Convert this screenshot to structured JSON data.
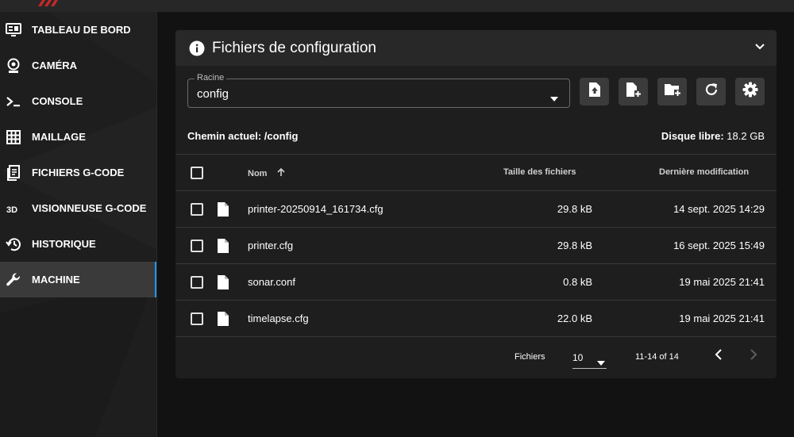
{
  "colors": {
    "accent": "#2196f3",
    "brand": "#c62828",
    "background": "#121212",
    "card": "#1e1e1e"
  },
  "sidebar": {
    "items": [
      {
        "label": "TABLEAU DE BORD",
        "icon": "monitor-dashboard-icon",
        "active": false
      },
      {
        "label": "CAMÉRA",
        "icon": "webcam-icon",
        "active": false
      },
      {
        "label": "CONSOLE",
        "icon": "console-icon",
        "active": false
      },
      {
        "label": "MAILLAGE",
        "icon": "grid-icon",
        "active": false
      },
      {
        "label": "FICHIERS G-CODE",
        "icon": "file-document-icon",
        "active": false
      },
      {
        "label": "VISIONNEUSE G-CODE",
        "icon": "3d-icon",
        "active": false
      },
      {
        "label": "HISTORIQUE",
        "icon": "history-icon",
        "active": false
      },
      {
        "label": "MACHINE",
        "icon": "wrench-icon",
        "active": true
      }
    ]
  },
  "panel": {
    "title": "Fichiers de configuration",
    "root_select": {
      "legend": "Racine",
      "value": "config"
    },
    "toolbar": [
      "upload-file-icon",
      "new-file-icon",
      "new-folder-icon",
      "refresh-icon",
      "settings-icon"
    ],
    "current_path_label": "Chemin actuel: /config",
    "disk_free_label": "Disque libre:",
    "disk_free_value": "18.2 GB"
  },
  "table": {
    "headers": {
      "name": "Nom",
      "size": "Taille des fichiers",
      "modified": "Dernière modification"
    },
    "rows": [
      {
        "name": "printer-20250914_161734.cfg",
        "size": "29.8 kB",
        "modified": "14 sept. 2025 14:29"
      },
      {
        "name": "printer.cfg",
        "size": "29.8 kB",
        "modified": "16 sept. 2025 15:49"
      },
      {
        "name": "sonar.conf",
        "size": "0.8 kB",
        "modified": "19 mai 2025 21:41"
      },
      {
        "name": "timelapse.cfg",
        "size": "22.0 kB",
        "modified": "19 mai 2025 21:41"
      }
    ]
  },
  "pagination": {
    "label": "Fichiers",
    "per_page": "10",
    "range": "11-14 of 14"
  }
}
